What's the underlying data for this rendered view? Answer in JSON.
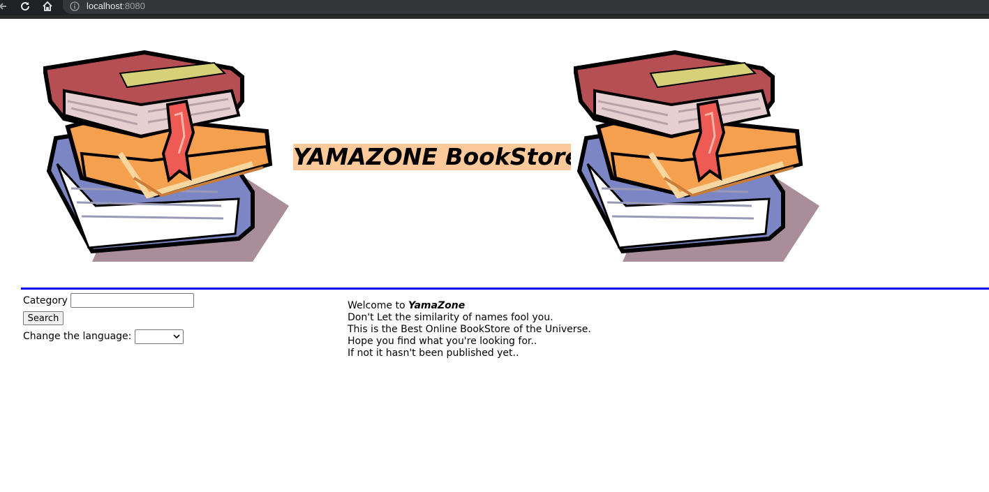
{
  "browser": {
    "url_host": "localhost",
    "url_port": ":8080"
  },
  "header": {
    "title": "YAMAZONE BookStore"
  },
  "search": {
    "category_label": "Category",
    "category_value": "",
    "search_button": "Search",
    "language_label": "Change the language:",
    "language_selected": ""
  },
  "welcome": {
    "intro": "Welcome to ",
    "brand": "YamaZone",
    "lines": [
      "Don't Let the similarity of names fool you.",
      "This is the Best Online BookStore of the Universe.",
      "Hope you find what you're looking for..",
      "If not it hasn't been published yet.."
    ]
  },
  "colors": {
    "title_background": "#fcc99a",
    "divider": "#0000ee"
  }
}
